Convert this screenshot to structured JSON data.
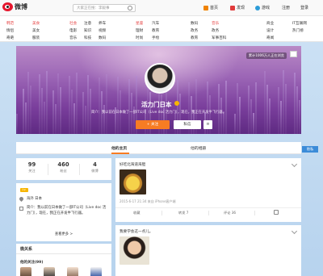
{
  "top": {
    "logo_text": "微博",
    "search_placeholder": "大家正在搜：李毅事",
    "nav": [
      "首页",
      "发现",
      "游戏",
      "注册",
      "登录"
    ]
  },
  "categories": [
    {
      "items": [
        "明星",
        "综艺",
        "搞笑"
      ],
      "accent": true
    },
    {
      "items": [
        "美女",
        "动漫",
        "萌宠"
      ]
    },
    {
      "items": [
        "时尚",
        "美妆",
        "星座"
      ]
    },
    {
      "items": [
        "社会",
        "电影",
        "电视剧"
      ]
    },
    {
      "items": [
        "体育",
        "财经",
        "汽车"
      ]
    },
    {
      "items": [
        "科技",
        "军事",
        "游戏"
      ]
    },
    {
      "items": [
        "旅游",
        "美食",
        "健康"
      ]
    },
    {
      "items": [
        "育儿",
        "房产",
        "艺术"
      ]
    },
    {
      "items": [
        "读书",
        "历史",
        "佛学"
      ]
    },
    {
      "items": [
        "设计",
        "艺术",
        "更多"
      ]
    }
  ],
  "cat_columns": [
    [
      "韩范",
      "情侣",
      "奇葩"
    ],
    [
      "美食",
      "美女",
      "服装"
    ],
    [
      "社会",
      "电影",
      "音乐"
    ],
    [
      "注意",
      "知识",
      "科技"
    ],
    [
      "养车",
      "视频",
      "数码"
    ],
    [
      "星座",
      "理财",
      "时尚"
    ],
    [
      "汽车",
      "教育",
      "手绘"
    ],
    [
      "数码",
      "政务",
      "教育"
    ],
    [
      "音乐",
      "政务",
      "军事百科"
    ],
    [
      "商业",
      "设计",
      "奇闻"
    ],
    [
      "IT互联网",
      "热门榜"
    ]
  ],
  "cover": {
    "badge": "累计1006万人正在浏览",
    "nickname": "活力门日本",
    "bio": "简介：我以前在日本做了一部IT公司（Live doc 活力门），现在，我正在开发半飞行器。",
    "follow_label": "+ 关注",
    "message_label": "私信",
    "more_label": "≡"
  },
  "tabs": [
    "他的主页",
    "他的相册"
  ],
  "side_tab": "隐私",
  "stats": [
    {
      "value": "99",
      "label": "关注"
    },
    {
      "value": "460",
      "label": "粉丝"
    },
    {
      "value": "4",
      "label": "微博"
    }
  ],
  "info": {
    "level": "Lv.",
    "location": "海外 日本",
    "bio": "简介：我以前在日本做了一部IT公司（Live doc 活力门），现在，我正在开发半飞行器。",
    "more": "查看更多 >"
  },
  "relations": {
    "title": "微关系",
    "following_title": "他的关注(99)"
  },
  "post1": {
    "text": "好吃北海道海胆",
    "meta": "2015-6-17 21:34 来自 iPhone客户端",
    "actions": [
      "收藏",
      "转发 7",
      "评论 36",
      "👍"
    ]
  },
  "post2": {
    "text": "我要学会这一点儿。"
  }
}
